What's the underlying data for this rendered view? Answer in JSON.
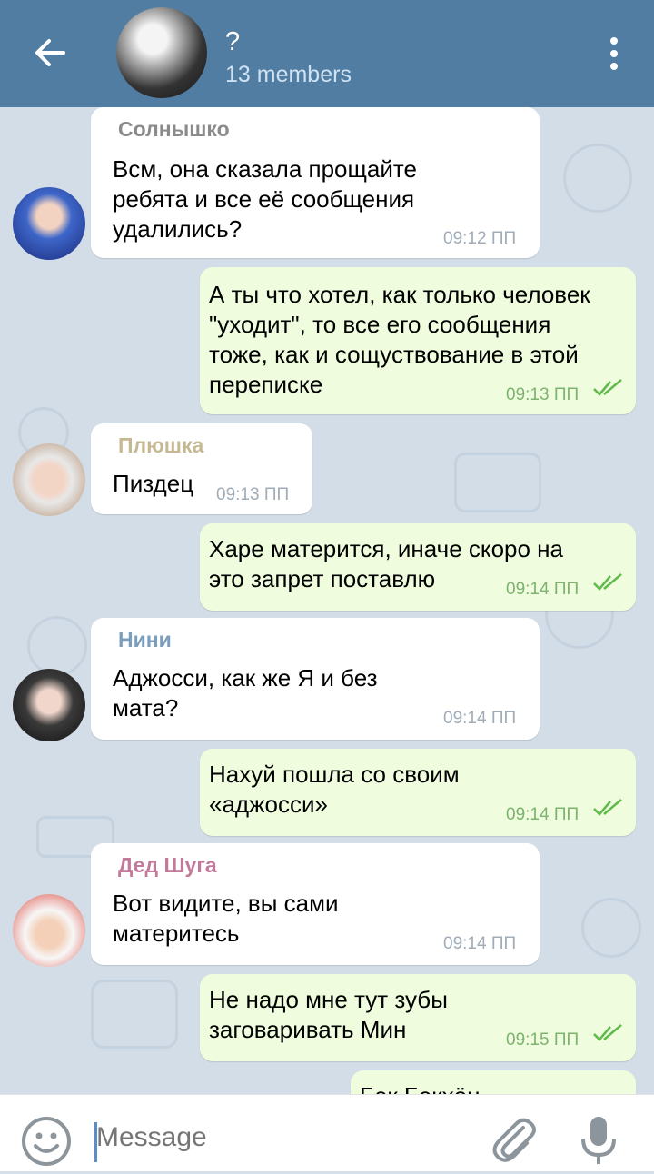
{
  "header": {
    "title": "?",
    "members": "13 members"
  },
  "messages": [
    {
      "direction": "in",
      "sender": "Солнышко",
      "sender_color": "#8b8b8b",
      "text": "Всм, она сказала прощайте\nребята и все её сообщения\nудалились?",
      "time": "09:12 ПП"
    },
    {
      "direction": "out",
      "text": "А ты что хотел, как только человек\n\"уходит\", то все его сообщения\nтоже, как и сощуствование в этой\nпереписке",
      "time": "09:13 ПП",
      "read": true
    },
    {
      "direction": "in",
      "sender": "Плюшка",
      "sender_color": "#c6b892",
      "text": "Пиздец",
      "time": "09:13 ПП"
    },
    {
      "direction": "out",
      "text": "Харе матерится, иначе скоро на\nэто запрет поставлю",
      "time": "09:14 ПП",
      "read": true
    },
    {
      "direction": "in",
      "sender": "Нини",
      "sender_color": "#7b9ebd",
      "text": "Аджосси, как же Я и без\nмата?",
      "time": "09:14 ПП"
    },
    {
      "direction": "out",
      "text": "Нахуй пошла со своим\n«аджосси»",
      "time": "09:14 ПП",
      "read": true
    },
    {
      "direction": "in",
      "sender": "Дед Шуга",
      "sender_color": "#c27a9a",
      "text": "Вот видите, вы сами\nматеритесь",
      "time": "09:14 ПП"
    },
    {
      "direction": "out",
      "text": "Не надо мне тут зубы\nзаговаривать Мин",
      "time": "09:15 ПП",
      "read": true
    },
    {
      "direction": "out",
      "text": "Бэк Бэкхён",
      "time": ""
    }
  ],
  "input": {
    "placeholder": "Message"
  },
  "colors": {
    "header": "#517da2",
    "incoming_bubble": "#ffffff",
    "outgoing_bubble": "#effdde",
    "read_ticks": "#5fb94b"
  }
}
